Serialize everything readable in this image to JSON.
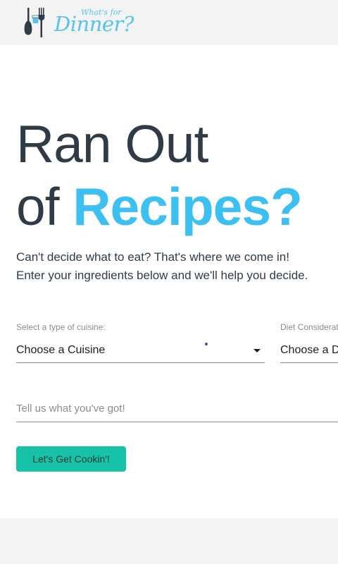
{
  "brand": {
    "tagline": "What's for",
    "name": "Dinner?"
  },
  "hero": {
    "line1": "Ran Out",
    "line2_prefix": "of ",
    "line2_accent": "Recipes?",
    "subtitle_line1": "Can't decide what to eat? That's where we come in!",
    "subtitle_line2": "Enter your ingredients below and we'll help you decide."
  },
  "form": {
    "cuisine": {
      "label": "Select a type of cuisine:",
      "value": "Choose a Cuisine"
    },
    "diet": {
      "label": "Diet Considerations",
      "value": "Choose a Diet"
    },
    "ingredients": {
      "placeholder": "Tell us what you've got!",
      "value": ""
    },
    "submit_label": "Let's Get Cookin'!"
  },
  "colors": {
    "accent": "#3cc0f2",
    "button": "#17c3a8",
    "text": "#2f3c48"
  },
  "icons": [
    "spoon-icon",
    "fork-icon",
    "water-glass-icon",
    "dropdown-arrow-icon"
  ]
}
